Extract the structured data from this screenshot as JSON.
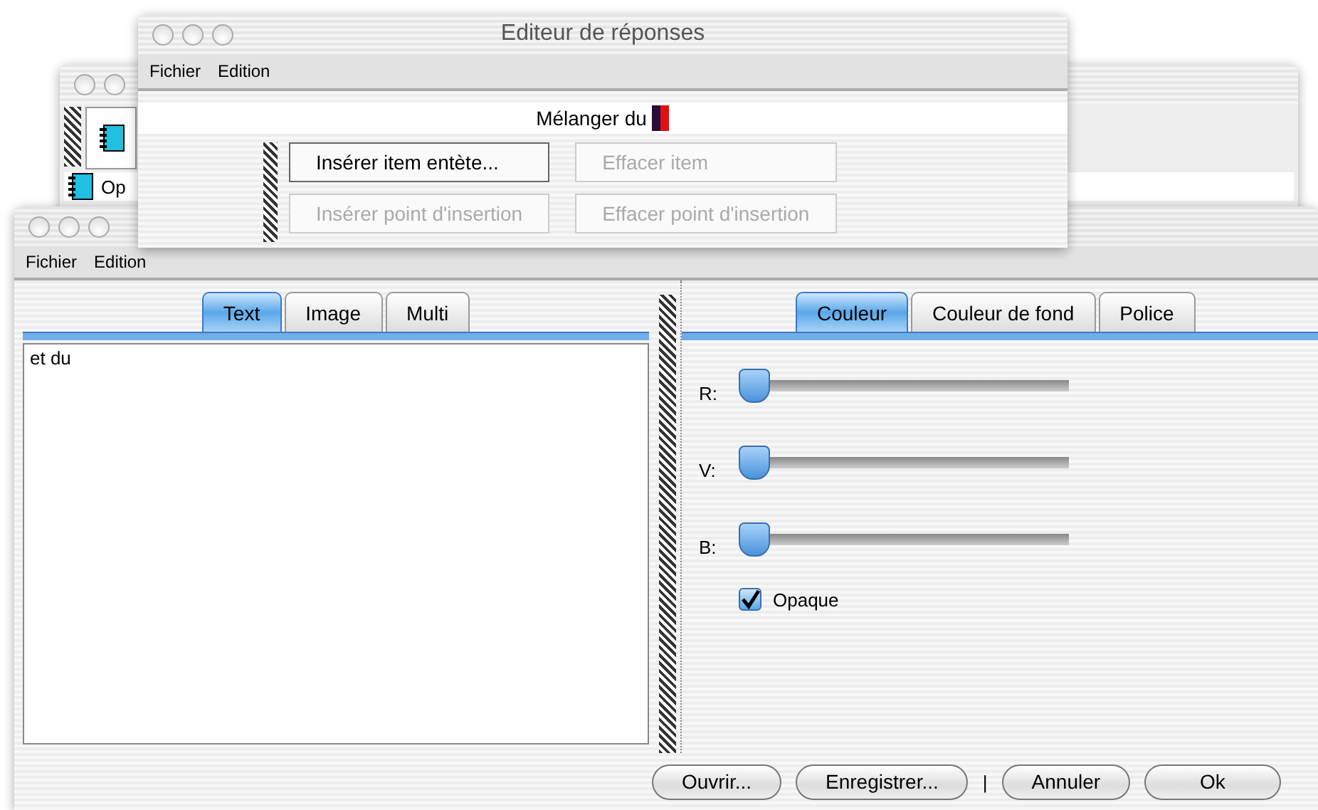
{
  "back_window": {
    "list_item": "Op"
  },
  "editor_window": {
    "title": "Editeur de réponses",
    "menu": [
      "Fichier",
      "Edition"
    ],
    "header": "Mélanger du",
    "buttons": [
      {
        "label": "Insérer item entète...",
        "disabled": false
      },
      {
        "label": "Effacer item",
        "disabled": true
      },
      {
        "label": "Insérer point d'insertion",
        "disabled": true
      },
      {
        "label": "Effacer point d'insertion",
        "disabled": true
      }
    ]
  },
  "main_window": {
    "menu": [
      "Fichier",
      "Edition"
    ],
    "left_tabs": [
      {
        "label": "Text",
        "selected": true
      },
      {
        "label": "Image",
        "selected": false
      },
      {
        "label": "Multi",
        "selected": false
      }
    ],
    "text": "et du",
    "right_tabs": [
      {
        "label": "Couleur",
        "selected": true
      },
      {
        "label": "Couleur de fond",
        "selected": false
      },
      {
        "label": "Police",
        "selected": false
      }
    ],
    "sliders": [
      {
        "label": "R:",
        "level": 0
      },
      {
        "label": "V:",
        "level": 0
      },
      {
        "label": "B:",
        "level": 0
      }
    ],
    "opaque": {
      "label": "Opaque",
      "checked": true
    },
    "buttons": [
      "Ouvrir...",
      "Enregistrer..."
    ],
    "separator": "|",
    "buttons_right": [
      "Annuler",
      "Ok"
    ]
  }
}
